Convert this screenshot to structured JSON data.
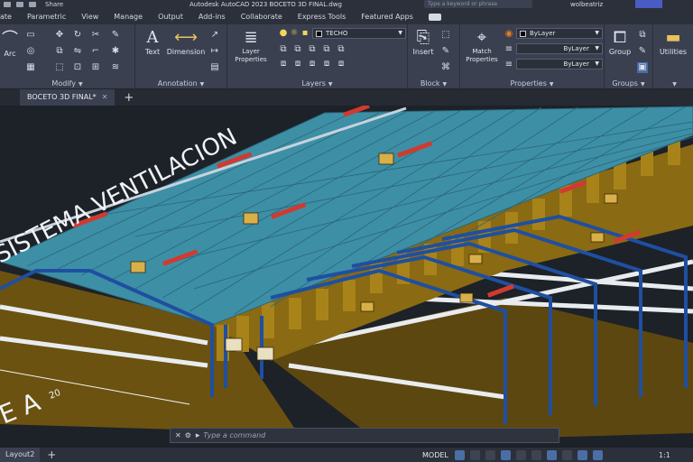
{
  "titlebar": {
    "share": "Share",
    "app_title": "Autodesk AutoCAD 2023   BOCETO 3D FINAL.dwg",
    "search_placeholder": "Type a keyword or phrase",
    "user": "wolbeatriz"
  },
  "menu_tabs": [
    "ate",
    "Parametric",
    "View",
    "Manage",
    "Output",
    "Add-ins",
    "Collaborate",
    "Express Tools",
    "Featured Apps"
  ],
  "ribbon": {
    "arc_label": "Arc",
    "modify_title": "Modify",
    "text_label": "Text",
    "dimension_label": "Dimension",
    "annotation_title": "Annotation",
    "layer_properties_label": "Layer Properties",
    "layer_name": "TECHO",
    "layers_title": "Layers",
    "insert_label": "Insert",
    "block_title": "Block",
    "match_properties_label": "Match Properties",
    "bylayer_color": "ByLayer",
    "bylayer_linetype": "ByLayer",
    "bylayer_lineweight": "ByLayer",
    "properties_title": "Properties",
    "group_label": "Group",
    "groups_title": "Groups",
    "utilities_label": "Utilities"
  },
  "doc_tab": {
    "name": "BOCETO 3D FINAL*"
  },
  "drawing": {
    "label_ventilacion": "SISTEMA VENTILACION",
    "label_bottom": "E A",
    "label_dim": "20"
  },
  "command": {
    "placeholder": "Type a command"
  },
  "status": {
    "layout_tab": "Layout2",
    "model": "MODEL",
    "scale": "1:1"
  },
  "colors": {
    "roof": "#3d8fa6",
    "frame": "#1f4fa0",
    "wall": "#8a6a12",
    "ground": "#6b5210",
    "accent": "#4b5bc4"
  }
}
